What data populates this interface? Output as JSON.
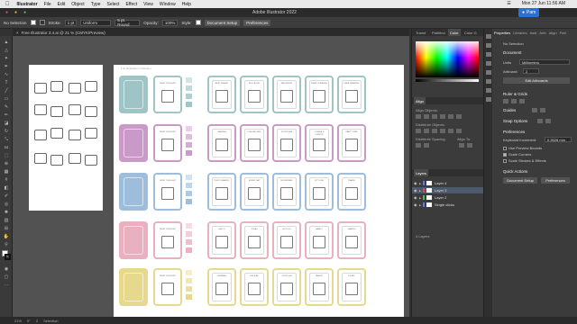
{
  "menubar": {
    "app_name": "Illustrator",
    "items": [
      "File",
      "Edit",
      "Object",
      "Type",
      "Select",
      "Effect",
      "View",
      "Window",
      "Help"
    ],
    "window_title": "Adobe Illustrator 2022",
    "clock": "Mon 27 Jun 11:56 AM",
    "user": "Pam"
  },
  "control_bar": {
    "selection": "No Selection",
    "stroke_label": "Stroke:",
    "stroke_value": "1 pt",
    "uniform_label": "Uniform",
    "brush_label": "5 pt. Round",
    "opacity_label": "Opacity:",
    "opacity_value": "100%",
    "style_label": "Style:",
    "doc_setup": "Document Setup",
    "preferences": "Preferences"
  },
  "document_tab": {
    "title": "Free Illustrator 3.4.ai @ 21 % (CMYK/Preview)"
  },
  "artboard": {
    "label": "Fun Illustration Collection",
    "accent_colors": [
      "#9fc4c6",
      "#c99ac8",
      "#9dbddb",
      "#e9b0c0",
      "#e6d98e"
    ],
    "row_titles": [
      [
        "BEST FRIEND",
        "FULL BOOK",
        "FAVOURITE",
        "SWEET FRIENDS",
        "FREE DRAWING"
      ],
      [
        "GARDEN",
        "PLAYGROUND",
        "STORYTIME",
        "COFFEE & DONUTS",
        "PARTY TIME"
      ],
      [
        "PHOTOGRAPHY",
        "SUNNY DAY",
        "MOUNTAINS",
        "CITY LIFE",
        "TRAVEL"
      ],
      [
        "HELLO",
        "TODAY",
        "LET'S GO",
        "FAMILY",
        "SNACKS"
      ],
      [
        "SUMMER",
        "HOLIDAY",
        "OUTDOOR",
        "BEACH",
        "PICNIC"
      ]
    ],
    "label_col": [
      "FIRST THOUGHT",
      "FIRST THOUGHT",
      "FIRST THOUGHT",
      "FIRST THOUGHT",
      "FIRST THOUGHT"
    ]
  },
  "color_panel": {
    "tabs": [
      "Transf",
      "Pathfind",
      "Color",
      "Color G"
    ]
  },
  "align_panel": {
    "tab": "Align",
    "align_objects": "Align Objects:",
    "distribute_objects": "Distribute Objects:",
    "distribute_spacing": "Distribute Spacing:",
    "align_to": "Align To:"
  },
  "layers_panel": {
    "tab": "Layers",
    "layers": [
      {
        "name": "Layer 4",
        "color": "#4e7cff",
        "selected": false
      },
      {
        "name": "Layer 3",
        "color": "#e04848",
        "selected": true
      },
      {
        "name": "Layer 2",
        "color": "#49c049",
        "selected": false
      },
      {
        "name": "Single clicks",
        "color": "#4e7cff",
        "selected": false
      }
    ],
    "footer": "4 Layers"
  },
  "properties_panel": {
    "tabs": [
      "Properties",
      "Libraries",
      "Asst",
      "Artb",
      "Align",
      "Patt"
    ],
    "no_selection": "No Selection",
    "document": "Document",
    "units_label": "Units",
    "units_value": "Millimeters",
    "artboard_label": "Artboard:",
    "artboard_value": "2",
    "edit_artboards": "Edit Artboards",
    "ruler_grids": "Ruler & Grids",
    "guides": "Guides",
    "snap_options": "Snap Options",
    "preferences": "Preferences",
    "keyboard_increment_label": "Keyboard Increment:",
    "keyboard_increment_value": "0.3528 mm",
    "use_preview_bounds": "Use Preview Bounds",
    "scale_corners": "Scale Corners",
    "scale_strokes": "Scale Strokes & Effects",
    "quick_actions": "Quick Actions",
    "doc_setup_btn": "Document Setup",
    "prefs_btn": "Preferences"
  },
  "status_bar": {
    "zoom": "21%",
    "angle": "0°",
    "artboard": "2",
    "tool": "Selection"
  }
}
